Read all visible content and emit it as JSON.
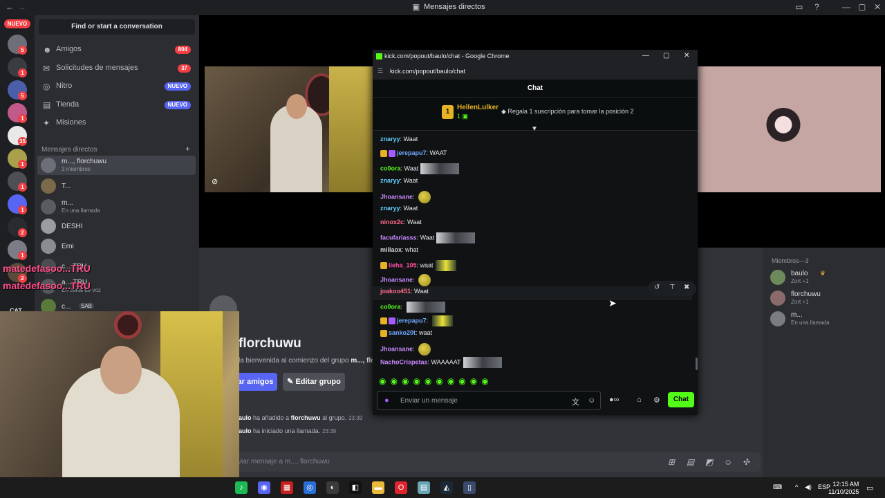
{
  "discord": {
    "window_title": "Mensajes directos",
    "rail": {
      "new_pill": "NUEVO",
      "servers": [
        {
          "badge": "5",
          "color": "#6d6f78"
        },
        {
          "badge": "1",
          "color": "#3a3c42"
        },
        {
          "badge": "5",
          "color": "#4b5eaa"
        },
        {
          "badge": "1",
          "color": "#c15a8a"
        },
        {
          "badge": "35",
          "color": "#e8e8e8"
        },
        {
          "badge": "1",
          "color": "#a8a04a"
        },
        {
          "badge": "1",
          "color": "#4d4f55"
        },
        {
          "badge": "1",
          "color": "#5865f2"
        },
        {
          "badge": "2",
          "color": "#2a2b2f"
        },
        {
          "badge": "1",
          "color": "#7a7d85"
        },
        {
          "badge": "2",
          "color": "#5c4a3a"
        }
      ],
      "cat_label": "CAT"
    },
    "sidebar": {
      "find_button": "Find or start a conversation",
      "nav": [
        {
          "label": "Amigos",
          "icon": "friends-icon",
          "badge": "804",
          "badge_color": "red"
        },
        {
          "label": "Solicitudes de mensajes",
          "icon": "mail-icon",
          "badge": "37",
          "badge_color": "red"
        },
        {
          "label": "Nitro",
          "icon": "nitro-icon",
          "badge": "NUEVO",
          "badge_color": "blue"
        },
        {
          "label": "Tienda",
          "icon": "shop-icon",
          "badge": "NUEVO",
          "badge_color": "blue"
        },
        {
          "label": "Misiones",
          "icon": "quests-icon",
          "badge": "",
          "badge_color": ""
        }
      ],
      "dm_header": "Mensajes directos",
      "dms": [
        {
          "name": "m..., florchuwu",
          "sub": "3 miembros",
          "color": "#6d6f78"
        },
        {
          "name": "T...",
          "sub": "",
          "color": "#7a6a4a"
        },
        {
          "name": "m...",
          "sub": "En una llamada",
          "color": "#5a5c62"
        },
        {
          "name": "DESHI",
          "sub": "",
          "color": "#9a9ca2"
        },
        {
          "name": "Erni",
          "sub": "",
          "color": "#8a8c92"
        },
        {
          "name": "c... TRU",
          "sub": "",
          "color": "#4a4c52"
        },
        {
          "name": "a... TRU",
          "sub": "En canal de voz",
          "color": "#55575d"
        },
        {
          "name": "c...",
          "sub": "",
          "color": "#5a7a3a",
          "tag": "SAB"
        }
      ]
    },
    "overlay_lines": [
      "matedefasoo...TRU",
      "matedefasoo...TRU"
    ],
    "group": {
      "title": "florchuwu",
      "description_prefix": "la bienvenida al comienzo del grupo ",
      "description_bold": "m..., flo",
      "invite_button": "ar amigos",
      "edit_button": "Editar grupo",
      "system_messages": [
        {
          "actor": "aulo",
          "text": " ha añadido a ",
          "target": "florchuwu",
          "suffix": " al grupo.",
          "time": "23:39"
        },
        {
          "actor": "aulo",
          "text": " ha iniciado una llamada.",
          "target": "",
          "suffix": "",
          "time": "23:39"
        }
      ],
      "input_placeholder": "viar mensaje a m..., florchuwu"
    },
    "members": {
      "header": "Miembros—3",
      "list": [
        {
          "name": "baulo",
          "crown": "♛",
          "sub": "Zort +1",
          "color": "#6d8a5a"
        },
        {
          "name": "florchuwu",
          "sub": "Zort +1",
          "color": "#8a6a6a"
        },
        {
          "name": "m...",
          "sub": "En una llamada",
          "color": "#7a7c82"
        }
      ]
    }
  },
  "chrome": {
    "title": "kick.com/popout/baulo/chat - Google Chrome",
    "url": "kick.com/popout/baulo/chat",
    "chat_header": "Chat",
    "pinned": {
      "rank": "1",
      "user": "HellenLulker",
      "count": "1",
      "gift_text": "Regala 1 suscripción para tomar la posición 2"
    },
    "messages": [
      {
        "user": "znaryy",
        "color": "#5fd3ff",
        "text": "Waat",
        "emote": "",
        "badges": 0
      },
      {
        "user": "jerepapu7",
        "color": "#6fa8ff",
        "text": "WAAT",
        "emote": "",
        "badges": 2
      },
      {
        "user": "co0ora",
        "color": "#53fc18",
        "text": "Waat",
        "emote": "img",
        "badges": 0
      },
      {
        "user": "znaryy",
        "color": "#5fd3ff",
        "text": "Waat",
        "emote": "",
        "badges": 0
      },
      {
        "user": "Jhoansane",
        "color": "#c88aff",
        "text": "",
        "emote": "orb",
        "badges": 0
      },
      {
        "user": "znaryy",
        "color": "#5fd3ff",
        "text": "Waat",
        "emote": "",
        "badges": 0
      },
      {
        "user": "ninox2c",
        "color": "#ff6b8a",
        "text": "Waat",
        "emote": "",
        "badges": 0
      },
      {
        "user": "facufariasss",
        "color": "#c88aff",
        "text": "Waat",
        "emote": "img",
        "badges": 0
      },
      {
        "user": "millaox",
        "color": "#d0d3d6",
        "text": "what",
        "emote": "",
        "badges": 0
      },
      {
        "user": "lieha_105",
        "color": "#ff4fa0",
        "text": "waat",
        "emote": "yel",
        "badges": 1
      },
      {
        "user": "Jhoansane",
        "color": "#c88aff",
        "text": "",
        "emote": "orb",
        "badges": 0
      },
      {
        "user": "joakoo451",
        "color": "#ff6b8a",
        "text": "Waat",
        "emote": "",
        "badges": 0
      },
      {
        "user": "co0ora",
        "color": "#53fc18",
        "text": "",
        "emote": "img",
        "badges": 0
      },
      {
        "user": "jerepapu7",
        "color": "#6fa8ff",
        "text": "",
        "emote": "yel",
        "badges": 2
      },
      {
        "user": "sanko20t",
        "color": "#6fa8ff",
        "text": "waat",
        "emote": "",
        "badges": 1
      },
      {
        "user": "Jhoansane",
        "color": "#c88aff",
        "text": "",
        "emote": "orb",
        "badges": 0
      },
      {
        "user": "NachoCrispetas",
        "color": "#c88aff",
        "text": "WAAAAAT",
        "emote": "img",
        "badges": 0
      }
    ],
    "emote_bar": "◉◉◉◉◉◉◉◉◉◉",
    "input_placeholder": "Enviar un mensaje",
    "chat_button": "Chat"
  },
  "taskbar": {
    "apps": [
      {
        "name": "spotify",
        "glyph": "♪",
        "color": "#1db954"
      },
      {
        "name": "discord",
        "glyph": "◉",
        "color": "#5865f2"
      },
      {
        "name": "voicemeeter",
        "glyph": "▦",
        "color": "#c8201e"
      },
      {
        "name": "chrome",
        "glyph": "◎",
        "color": "#2a6fd6"
      },
      {
        "name": "obs",
        "glyph": "◐",
        "color": "#3a3a3a"
      },
      {
        "name": "capcut",
        "glyph": "◧",
        "color": "#111111"
      },
      {
        "name": "explorer",
        "glyph": "▬",
        "color": "#e8b93a"
      },
      {
        "name": "opera",
        "glyph": "O",
        "color": "#e0242e"
      },
      {
        "name": "app",
        "glyph": "▤",
        "color": "#6aa6b8"
      },
      {
        "name": "steam",
        "glyph": "◭",
        "color": "#1b2838"
      },
      {
        "name": "app2",
        "glyph": "▯",
        "color": "#3a4a6a"
      }
    ],
    "lang": "ESP",
    "time": "12:15 AM",
    "date": "11/10/2025"
  }
}
